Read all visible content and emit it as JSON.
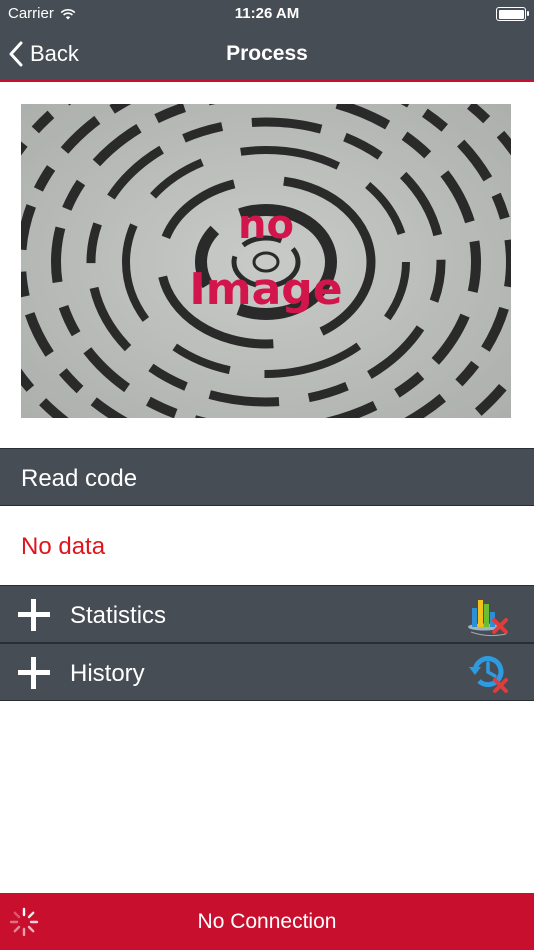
{
  "status_bar": {
    "carrier": "Carrier",
    "time": "11:26 AM"
  },
  "nav": {
    "back_label": "Back",
    "title": "Process"
  },
  "image_placeholder": {
    "line1": "no",
    "line2": "Image"
  },
  "read_code": {
    "title": "Read code",
    "value": "No data"
  },
  "sections": {
    "statistics": {
      "label": "Statistics",
      "icon": "statistics-disabled-icon"
    },
    "history": {
      "label": "History",
      "icon": "history-disabled-icon"
    }
  },
  "footer": {
    "status": "No Connection",
    "icon": "loading-spinner-icon"
  },
  "colors": {
    "bar_bg": "#474d55",
    "accent_red": "#c8102e",
    "no_data_red": "#e0151c",
    "placeholder_text": "#d2154a"
  }
}
